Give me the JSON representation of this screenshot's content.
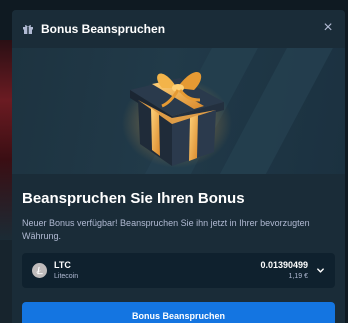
{
  "modal": {
    "title": "Bonus Beanspruchen",
    "close_symbol": "×"
  },
  "content": {
    "headline": "Beanspruchen Sie Ihren Bonus",
    "description": "Neuer Bonus verfügbar! Beanspruchen Sie ihn jetzt in Ihrer bevorzugten Währung."
  },
  "currency": {
    "code": "LTC",
    "name": "Litecoin",
    "amount": "0.01390499",
    "fiat": "1,19 €",
    "icon": "litecoin-icon"
  },
  "button": {
    "label": "Bonus Beanspruchen"
  },
  "colors": {
    "modal_bg": "#1a2c38",
    "input_bg": "#0f212e",
    "accent": "#1475e1",
    "muted_text": "#b1bad3"
  }
}
